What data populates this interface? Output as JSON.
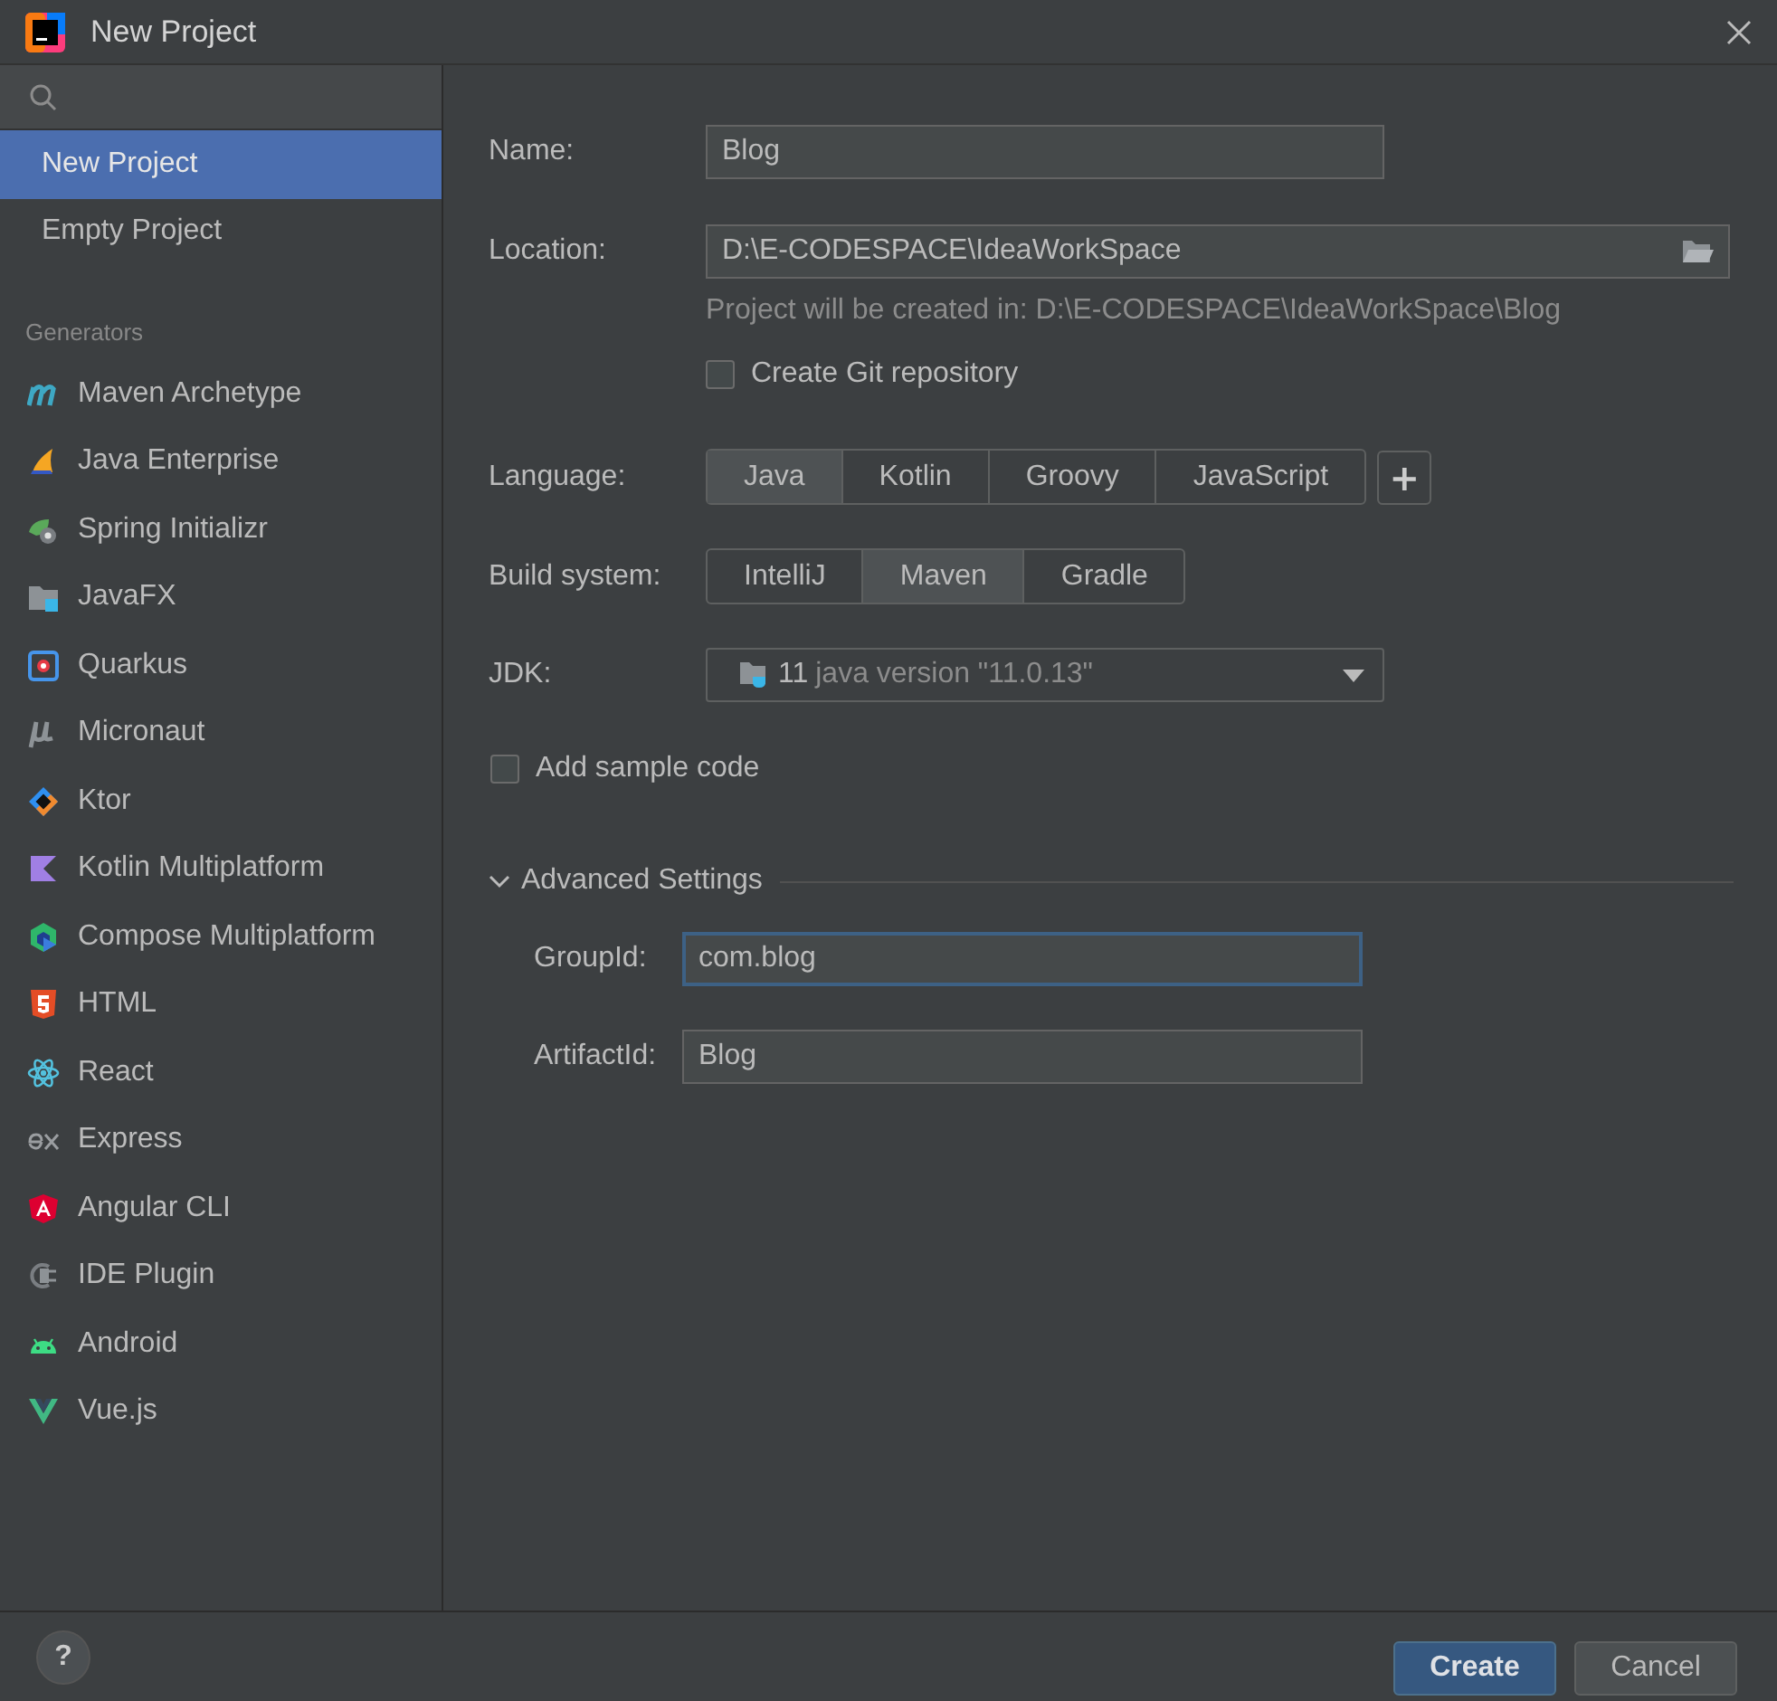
{
  "window": {
    "title": "New Project"
  },
  "sidebar": {
    "items": [
      {
        "label": "New Project",
        "selected": true
      },
      {
        "label": "Empty Project",
        "selected": false
      }
    ],
    "generators_heading": "Generators",
    "generators": [
      {
        "label": "Maven Archetype",
        "kind": "maven",
        "selected": false
      },
      {
        "label": "Java Enterprise",
        "kind": "flame",
        "selected": false
      },
      {
        "label": "Spring Initializr",
        "kind": "spring",
        "selected": false
      },
      {
        "label": "JavaFX",
        "kind": "folder",
        "selected": false
      },
      {
        "label": "Quarkus",
        "kind": "quarkus",
        "selected": false
      },
      {
        "label": "Micronaut",
        "kind": "mu",
        "selected": false
      },
      {
        "label": "Ktor",
        "kind": "ktor",
        "selected": false
      },
      {
        "label": "Kotlin Multiplatform",
        "kind": "kotlin",
        "selected": false
      },
      {
        "label": "Compose Multiplatform",
        "kind": "compose",
        "selected": false
      },
      {
        "label": "HTML",
        "kind": "html",
        "selected": false
      },
      {
        "label": "React",
        "kind": "react",
        "selected": false
      },
      {
        "label": "Express",
        "kind": "express",
        "selected": false
      },
      {
        "label": "Angular CLI",
        "kind": "angular",
        "selected": false
      },
      {
        "label": "IDE Plugin",
        "kind": "plug",
        "selected": false
      },
      {
        "label": "Android",
        "kind": "android",
        "selected": false
      },
      {
        "label": "Vue.js",
        "kind": "vue",
        "selected": false
      }
    ]
  },
  "form": {
    "name": {
      "label": "Name:",
      "value": "Blog"
    },
    "location": {
      "label": "Location:",
      "value": "D:\\E-CODESPACE\\IdeaWorkSpace",
      "hint": "Project will be created in: D:\\E-CODESPACE\\IdeaWorkSpace\\Blog"
    },
    "git": {
      "label": "Create Git repository",
      "checked": false
    },
    "language": {
      "label": "Language:",
      "add": "+",
      "options": [
        {
          "label": "Java",
          "selected": true
        },
        {
          "label": "Kotlin",
          "selected": false
        },
        {
          "label": "Groovy",
          "selected": false
        },
        {
          "label": "JavaScript",
          "selected": false
        }
      ]
    },
    "build_system": {
      "label": "Build system:",
      "options": [
        {
          "label": "IntelliJ",
          "selected": false
        },
        {
          "label": "Maven",
          "selected": true
        },
        {
          "label": "Gradle",
          "selected": false
        }
      ]
    },
    "jdk": {
      "label": "JDK:",
      "version": "11",
      "detail": "java version \"11.0.13\""
    },
    "sample_code": {
      "label": "Add sample code",
      "checked": false
    },
    "advanced": {
      "label": "Advanced Settings",
      "expanded": true,
      "fields": [
        {
          "label": "GroupId:",
          "value": "com.blog",
          "focused": true
        },
        {
          "label": "ArtifactId:",
          "value": "Blog",
          "focused": false
        }
      ]
    }
  },
  "footer": {
    "help": "?",
    "buttons": [
      {
        "label": "Create",
        "kind": "primary"
      },
      {
        "label": "Cancel",
        "kind": "secondary"
      }
    ]
  }
}
